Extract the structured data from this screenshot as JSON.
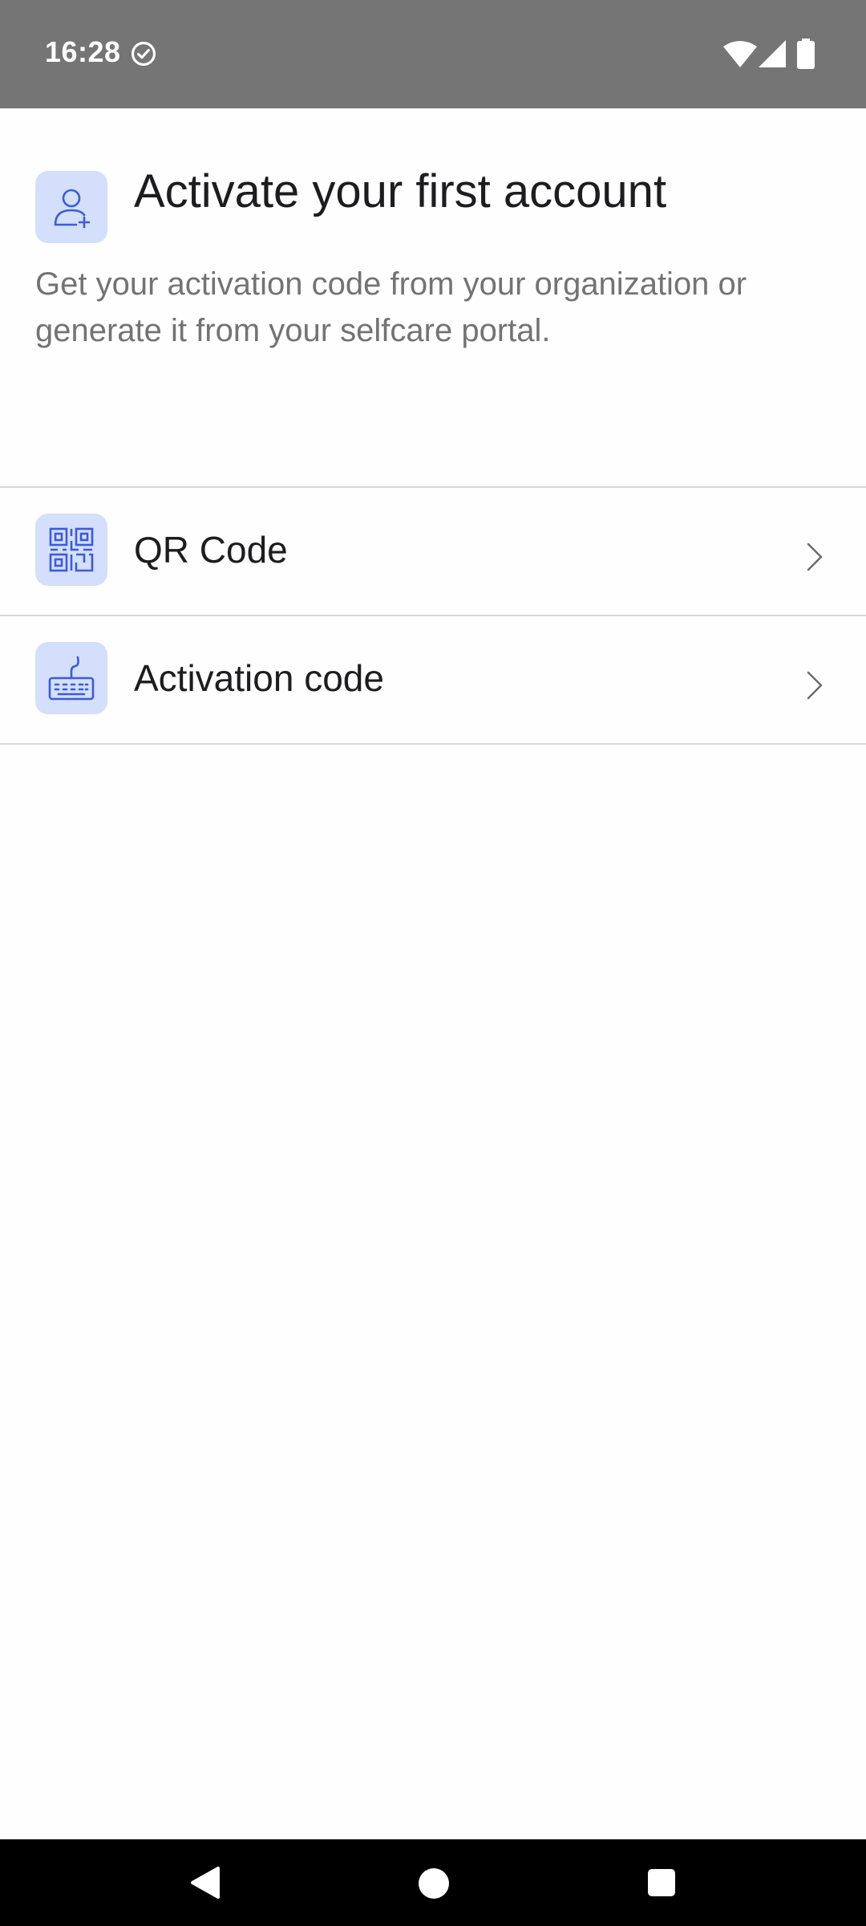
{
  "status_bar": {
    "time": "16:28",
    "icons": [
      "check-circle-icon",
      "wifi-icon",
      "signal-icon",
      "battery-icon"
    ]
  },
  "header": {
    "icon": "add-user-icon",
    "title": "Activate your first account",
    "subtitle": "Get your activation code from your organization or generate it from your selfcare portal."
  },
  "options": [
    {
      "label": "QR Code",
      "icon": "qr-code-icon"
    },
    {
      "label": "Activation code",
      "icon": "keyboard-icon"
    }
  ],
  "nav_bar": {
    "icons": [
      "back-icon",
      "home-icon",
      "recents-icon"
    ]
  },
  "colors": {
    "accent": "#3d5bd9",
    "tile_background": "#d3dffb",
    "status_bar": "#757575",
    "title_text": "#1d1d1f",
    "subtitle_text": "#737373"
  }
}
